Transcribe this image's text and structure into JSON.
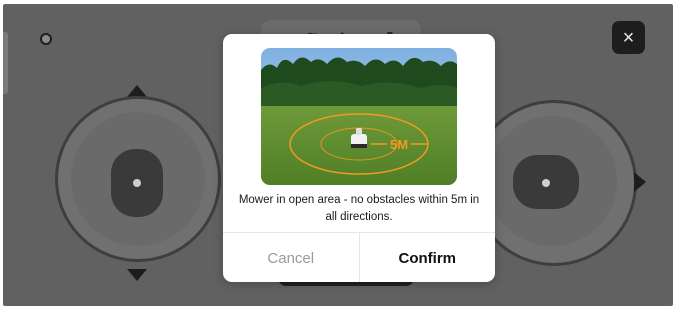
{
  "dialog": {
    "message": "Mower in open area - no obstacles within 5m in all directions.",
    "image_annotation": "5M",
    "cancel_label": "Cancel",
    "confirm_label": "Confirm"
  },
  "top_bar": {
    "close_label": "×"
  },
  "colors": {
    "annotation": "#f39a1e",
    "overlay": "#616161",
    "dialog_bg": "#ffffff"
  }
}
